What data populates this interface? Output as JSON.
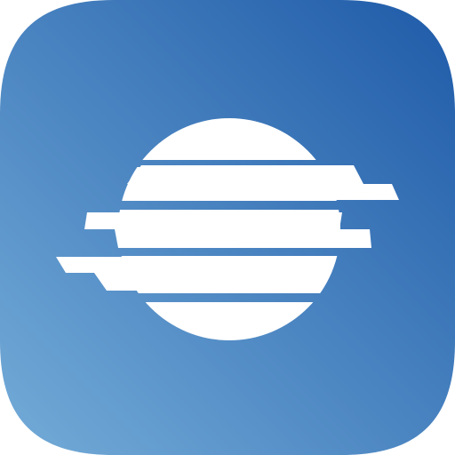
{
  "icon": {
    "name": "weather-app-icon",
    "glyph": "sun-behind-horizontal-stripes",
    "colors": {
      "gradient_start": "#1e5aa8",
      "gradient_end": "#74acd8",
      "foreground": "#ffffff"
    }
  }
}
